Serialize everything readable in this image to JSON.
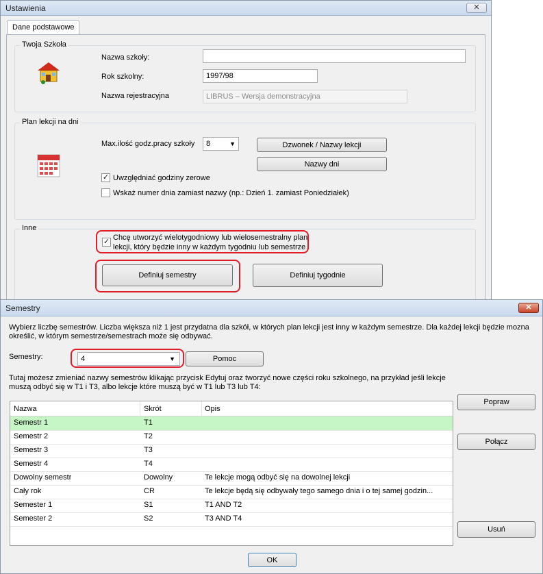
{
  "settings": {
    "title": "Ustawienia",
    "close": "✕",
    "tab": "Dane podstawowe",
    "school_group": {
      "label": "Twoja Szkoła",
      "name_label": "Nazwa szkoły:",
      "name_value": "",
      "year_label": "Rok szkolny:",
      "year_value": "1997/98",
      "reg_label": "Nazwa rejestracyjna",
      "reg_value": "LIBRUS – Wersja demonstracyjna"
    },
    "plan_group": {
      "label": "Plan lekcji na dni",
      "max_label": "Max.ilość godz.pracy szkoły",
      "max_value": "8",
      "bell_button": "Dzwonek / Nazwy lekcji",
      "days_button": "Nazwy dni",
      "zero_hours_label": "Uwzględniać godziny zerowe",
      "zero_hours_checked": true,
      "day_number_label": "Wskaż numer dnia zamiast nazwy (np.: Dzień 1. zamiast Poniedziałek)",
      "day_number_checked": false
    },
    "other_group": {
      "label": "Inne",
      "multiweek_label_line1": "Chcę utworzyć wielotygodniowy lub wielosemestralny plan",
      "multiweek_label_line2": "lekcji, który będzie inny w każdym tygodniu lub semestrze",
      "multiweek_checked": true,
      "semesters_button": "Definiuj semestry",
      "weeks_button": "Definiuj tygodnie"
    }
  },
  "semestry": {
    "title": "Semestry",
    "close": "✕",
    "intro": "Wybierz liczbę semestrów. Liczba większa niż 1 jest przydatna dla szkół, w których plan lekcji jest inny w każdym semestrze. Dla każdej lekcji będzie mozna określić, w którym semestrze/semestrach może się odbywać.",
    "count_label": "Semestry:",
    "count_value": "4",
    "help_button": "Pomoc",
    "info": "Tutaj możesz zmieniać nazwy semestrów klikając przycisk Edytuj oraz tworzyć nowe części roku szkolnego, na przykład jeśli lekcje muszą odbyć się w T1 i T3, albo lekcje które muszą być w T1 lub T3 lub T4:",
    "columns": [
      "Nazwa",
      "Skrót",
      "Opis"
    ],
    "rows": [
      {
        "name": "Semestr 1",
        "short": "T1",
        "desc": ""
      },
      {
        "name": "Semestr 2",
        "short": "T2",
        "desc": ""
      },
      {
        "name": "Semestr 3",
        "short": "T3",
        "desc": ""
      },
      {
        "name": "Semestr 4",
        "short": "T4",
        "desc": ""
      },
      {
        "name": "Dowolny semestr",
        "short": "Dowolny",
        "desc": "Te lekcje mogą odbyć się na dowolnej lekcji"
      },
      {
        "name": "Cały rok",
        "short": "CR",
        "desc": "Te lekcje będą się odbywały tego samego dnia i o tej samej godzin..."
      },
      {
        "name": "Semester 1",
        "short": "S1",
        "desc": "T1 AND T2"
      },
      {
        "name": "Semester 2",
        "short": "S2",
        "desc": "T3 AND T4"
      }
    ],
    "selected_row_color": "#c6f6c6",
    "edit_button": "Popraw",
    "join_button": "Połącz",
    "delete_button": "Usuń",
    "ok_button": "OK"
  },
  "colors": {
    "highlight": "#e11d2a",
    "selection": "#c6f6c6"
  }
}
